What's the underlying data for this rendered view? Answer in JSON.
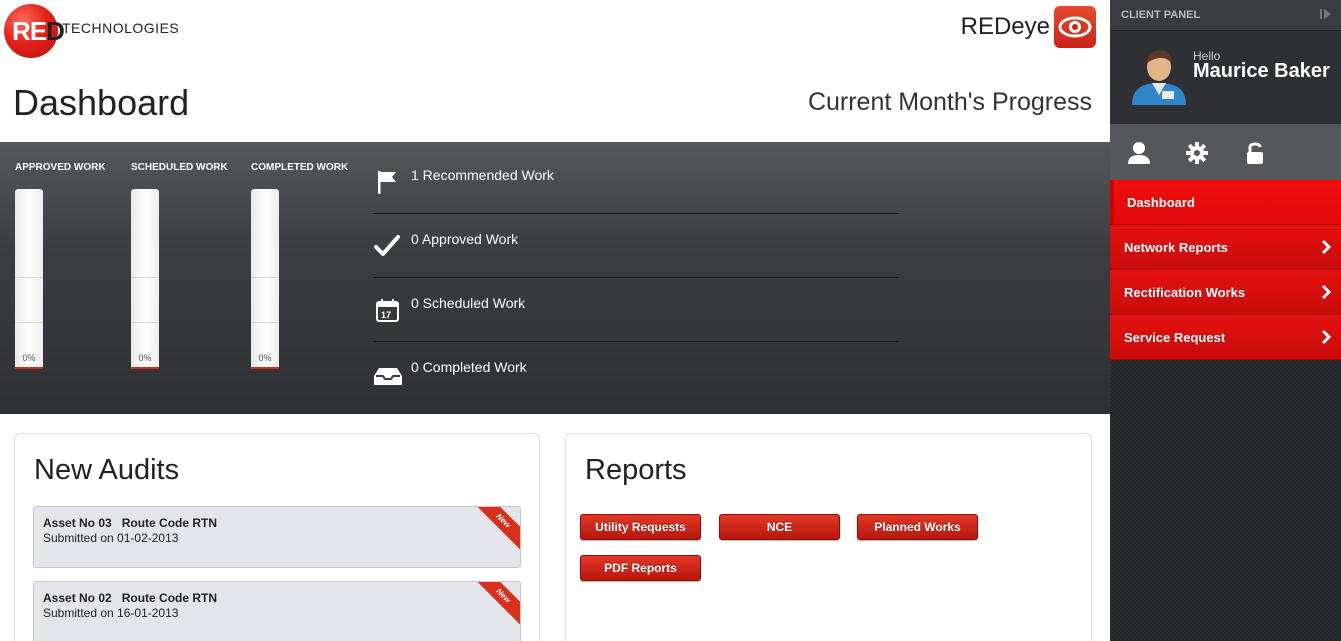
{
  "brand": {
    "logo_red": "RE",
    "logo_d": "D",
    "logo_tech": "TECHNOLOGIES",
    "product": "REDeye",
    "product_icon": "eye-icon"
  },
  "header": {
    "title": "Dashboard",
    "progress_title": "Current Month's Progress"
  },
  "progress": {
    "bars": [
      {
        "label": "APPROVED WORK",
        "value": "0%",
        "fraction": 0
      },
      {
        "label": "SCHEDULED WORK",
        "value": "0%",
        "fraction": 0
      },
      {
        "label": "COMPLETED WORK",
        "value": "0%",
        "fraction": 0
      }
    ],
    "stats": [
      {
        "icon": "flag-icon",
        "text": "1 Recommended Work"
      },
      {
        "icon": "checkmark-icon",
        "text": "0 Approved Work"
      },
      {
        "icon": "calendar-icon",
        "text": "0 Scheduled Work",
        "calendar_day": "17"
      },
      {
        "icon": "inbox-tray-icon",
        "text": "0 Completed Work"
      }
    ]
  },
  "audits": {
    "title": "New Audits",
    "items": [
      {
        "title": "Asset No 03   Route Code RTN",
        "submitted": "Submitted on 01-02-2013",
        "badge": "New"
      },
      {
        "title": "Asset No 02   Route Code RTN",
        "submitted": "Submitted on 16-01-2013",
        "badge": "New"
      }
    ]
  },
  "reports": {
    "title": "Reports",
    "buttons": [
      "Utility Requests",
      "NCE",
      "Planned Works",
      "PDF Reports"
    ]
  },
  "sidebar": {
    "panel_label": "CLIENT PANEL",
    "greeting": "Hello",
    "user_name": "Maurice Baker",
    "icons": [
      "user-icon",
      "gear-icon",
      "lock-icon"
    ],
    "menu": [
      {
        "label": "Dashboard",
        "active": true
      },
      {
        "label": "Network Reports",
        "active": false
      },
      {
        "label": "Rectification Works",
        "active": false
      },
      {
        "label": "Service Request",
        "active": false
      }
    ]
  },
  "colors": {
    "accent_red": "#e31b1b",
    "panel_dark": "#3b3d40",
    "sidebar_dark": "#2b2c2e"
  }
}
